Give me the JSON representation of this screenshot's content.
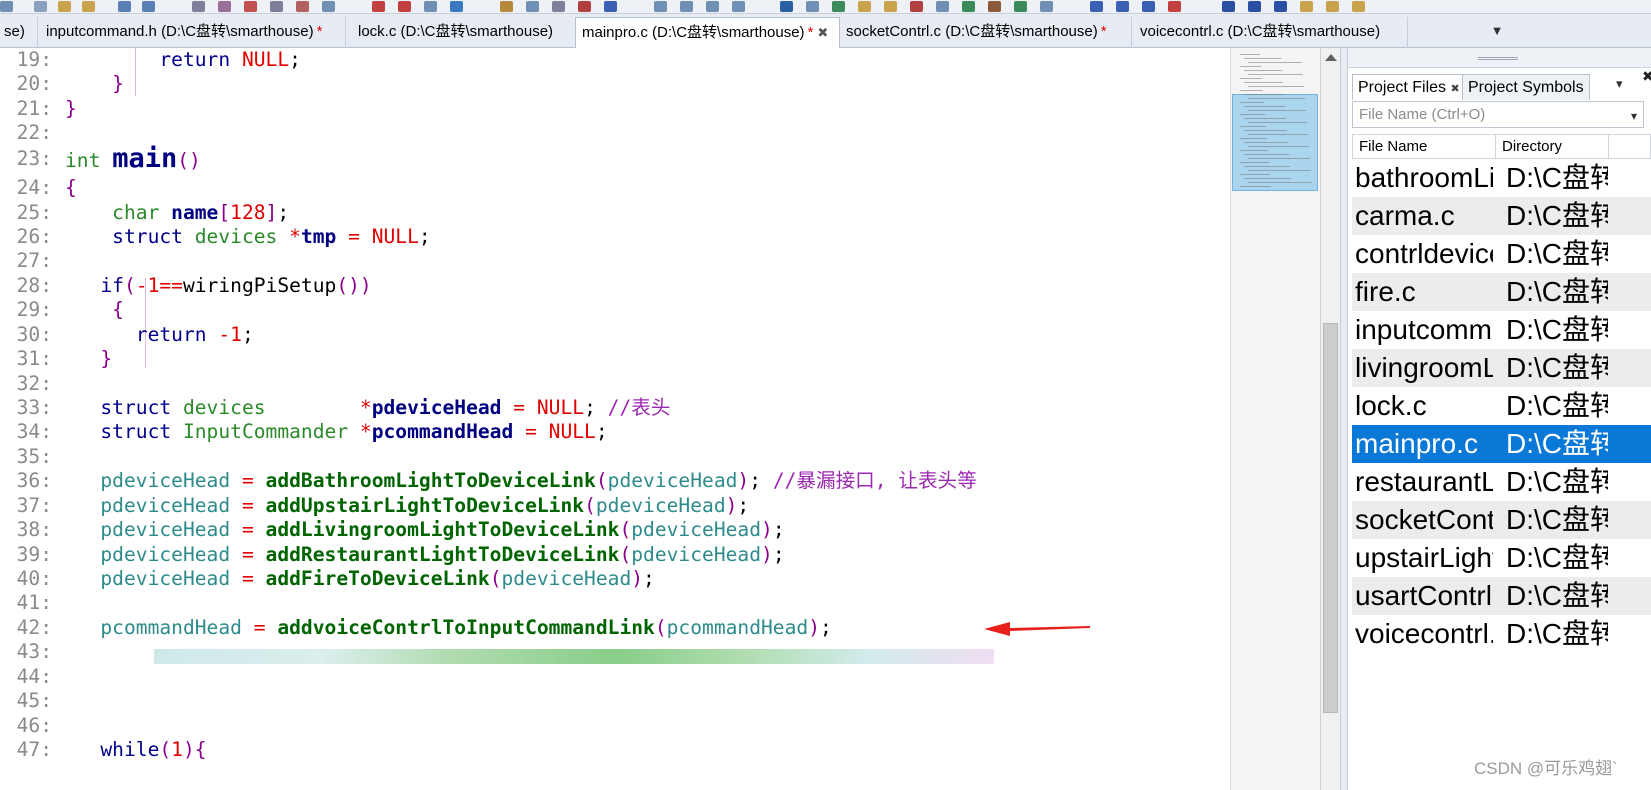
{
  "tabs": [
    {
      "label": "se)",
      "modified": false,
      "active": false
    },
    {
      "label": "inputcommand.h (D:\\C盘转\\smarthouse)",
      "modified": true,
      "active": false
    },
    {
      "label": "lock.c (D:\\C盘转\\smarthouse)",
      "modified": false,
      "active": false
    },
    {
      "label": "mainpro.c (D:\\C盘转\\smarthouse)",
      "modified": true,
      "active": true,
      "close": "✖"
    },
    {
      "label": "socketContrl.c (D:\\C盘转\\smarthouse)",
      "modified": true,
      "active": false
    },
    {
      "label": "voicecontrl.c (D:\\C盘转\\smarthouse)",
      "modified": false,
      "active": false
    }
  ],
  "tab_modified_mark": "*",
  "tab_overflow_icon": "chevron-down-icon",
  "editor": {
    "line_numbers": [
      "19:",
      "20:",
      "21:",
      "22:",
      "23:",
      "24:",
      "25:",
      "26:",
      "27:",
      "28:",
      "29:",
      "30:",
      "31:",
      "32:",
      "33:",
      "34:",
      "35:",
      "36:",
      "37:",
      "38:",
      "39:",
      "40:",
      "41:",
      "42:",
      "43:",
      "44:",
      "45:",
      "46:",
      "47:"
    ],
    "lines": [
      [
        [
          "kw",
          "        return "
        ],
        [
          "nu",
          "NULL"
        ],
        [
          "plain",
          ";"
        ]
      ],
      [
        [
          "pu",
          "    }"
        ]
      ],
      [
        [
          "pu",
          "}"
        ]
      ],
      [],
      [
        [
          "ty",
          "int "
        ],
        [
          "nm",
          "main"
        ],
        [
          "pu",
          "()"
        ]
      ],
      [
        [
          "pu",
          "{"
        ]
      ],
      [
        [
          "ty",
          "    char "
        ],
        [
          "nm",
          "name"
        ],
        [
          "pu",
          "["
        ],
        [
          "nu",
          "128"
        ],
        [
          "pu",
          "]"
        ],
        [
          "plain",
          ";"
        ]
      ],
      [
        [
          "kw",
          "    struct "
        ],
        [
          "ty",
          "devices "
        ],
        [
          "nu",
          "*"
        ],
        [
          "nm",
          "tmp "
        ],
        [
          "nu",
          "= NULL"
        ],
        [
          "plain",
          ";"
        ]
      ],
      [],
      [
        [
          "kw",
          "   if"
        ],
        [
          "pu",
          "("
        ],
        [
          "nu",
          "-1=="
        ],
        [
          "plain",
          "wiringPiSetup"
        ],
        [
          "pu",
          "())"
        ]
      ],
      [
        [
          "pu",
          "    {"
        ]
      ],
      [
        [
          "kw",
          "      return "
        ],
        [
          "nu",
          "-1"
        ],
        [
          "plain",
          ";"
        ]
      ],
      [
        [
          "pu",
          "   }"
        ]
      ],
      [],
      [
        [
          "kw",
          "   struct "
        ],
        [
          "ty",
          "devices        "
        ],
        [
          "nu",
          "*"
        ],
        [
          "nm",
          "pdeviceHead "
        ],
        [
          "nu",
          "= NULL"
        ],
        [
          "plain",
          "; "
        ],
        [
          "cm",
          "//表头"
        ]
      ],
      [
        [
          "kw",
          "   struct "
        ],
        [
          "ty",
          "InputCommander "
        ],
        [
          "nu",
          "*"
        ],
        [
          "nm",
          "pcommandHead "
        ],
        [
          "nu",
          "= NULL"
        ],
        [
          "plain",
          ";"
        ]
      ],
      [],
      [
        [
          "vr",
          "   pdeviceHead "
        ],
        [
          "nu",
          "= "
        ],
        [
          "fn",
          "addBathroomLightToDeviceLink"
        ],
        [
          "pu",
          "("
        ],
        [
          "vr",
          "pdeviceHead"
        ],
        [
          "pu",
          ")"
        ],
        [
          "plain",
          "; "
        ],
        [
          "cm",
          "//暴漏接口, 让表头等"
        ]
      ],
      [
        [
          "vr",
          "   pdeviceHead "
        ],
        [
          "nu",
          "= "
        ],
        [
          "fn",
          "addUpstairLightToDeviceLink"
        ],
        [
          "pu",
          "("
        ],
        [
          "vr",
          "pdeviceHead"
        ],
        [
          "pu",
          ")"
        ],
        [
          "plain",
          ";"
        ]
      ],
      [
        [
          "vr",
          "   pdeviceHead "
        ],
        [
          "nu",
          "= "
        ],
        [
          "fn",
          "addLivingroomLightToDeviceLink"
        ],
        [
          "pu",
          "("
        ],
        [
          "vr",
          "pdeviceHead"
        ],
        [
          "pu",
          ")"
        ],
        [
          "plain",
          ";"
        ]
      ],
      [
        [
          "vr",
          "   pdeviceHead "
        ],
        [
          "nu",
          "= "
        ],
        [
          "fn",
          "addRestaurantLightToDeviceLink"
        ],
        [
          "pu",
          "("
        ],
        [
          "vr",
          "pdeviceHead"
        ],
        [
          "pu",
          ")"
        ],
        [
          "plain",
          ";"
        ]
      ],
      [
        [
          "vr",
          "   pdeviceHead "
        ],
        [
          "nu",
          "= "
        ],
        [
          "fn",
          "addFireToDeviceLink"
        ],
        [
          "pu",
          "("
        ],
        [
          "vr",
          "pdeviceHead"
        ],
        [
          "pu",
          ")"
        ],
        [
          "plain",
          ";"
        ]
      ],
      [],
      [
        [
          "vr",
          "   pcommandHead "
        ],
        [
          "nu",
          "= "
        ],
        [
          "fn",
          "addvoiceContrlToInputCommandLink"
        ],
        [
          "pu",
          "("
        ],
        [
          "vr",
          "pcommandHead"
        ],
        [
          "pu",
          ")"
        ],
        [
          "plain",
          ";"
        ]
      ],
      [],
      [],
      [],
      [],
      [
        [
          "kw",
          "   while"
        ],
        [
          "pu",
          "("
        ],
        [
          "nu",
          "1"
        ],
        [
          "pu",
          "){"
        ]
      ]
    ]
  },
  "right_panel": {
    "tabs": [
      {
        "label": "Project Files",
        "active": true,
        "close": "✖"
      },
      {
        "label": "Project Symbols",
        "active": false
      }
    ],
    "panel_close": "✖",
    "chevron": "▾",
    "search_placeholder": "File Name (Ctrl+O)",
    "search_dropdown": "▾",
    "columns": [
      "File Name",
      "Directory"
    ],
    "files": [
      {
        "name": "bathroomLight.c",
        "dir": "D:\\C盘转"
      },
      {
        "name": "carma.c",
        "dir": "D:\\C盘转"
      },
      {
        "name": "contrldevices.h",
        "dir": "D:\\C盘转"
      },
      {
        "name": "fire.c",
        "dir": "D:\\C盘转"
      },
      {
        "name": "inputcommand.h",
        "dir": "D:\\C盘转"
      },
      {
        "name": "livingroomLight.c",
        "dir": "D:\\C盘转"
      },
      {
        "name": "lock.c",
        "dir": "D:\\C盘转"
      },
      {
        "name": "mainpro.c",
        "dir": "D:\\C盘转",
        "selected": true
      },
      {
        "name": "restaurantLight.c",
        "dir": "D:\\C盘转"
      },
      {
        "name": "socketContrl.c",
        "dir": "D:\\C盘转"
      },
      {
        "name": "upstairLight.c",
        "dir": "D:\\C盘转"
      },
      {
        "name": "usartContrl.c",
        "dir": "D:\\C盘转"
      },
      {
        "name": "voicecontrl.c",
        "dir": "D:\\C盘转"
      }
    ]
  },
  "watermark": "CSDN @可乐鸡翅`",
  "colors": {
    "accent_selection": "#0a78d7",
    "modified_mark": "#e00000",
    "annotation_arrow": "#e8201c"
  }
}
